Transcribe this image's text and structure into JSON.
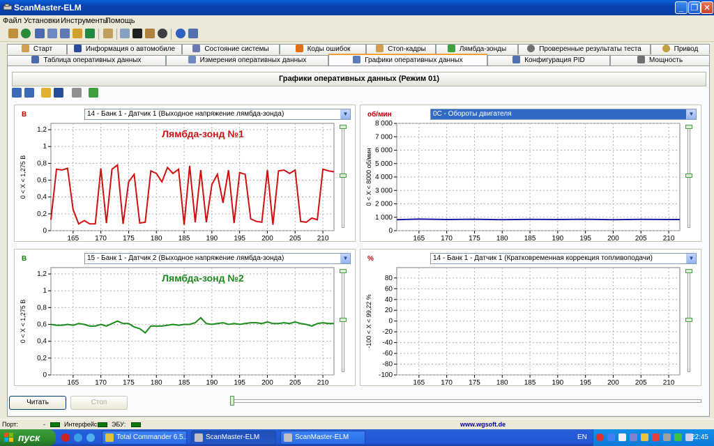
{
  "window": {
    "title": "ScanMaster-ELM"
  },
  "menu": [
    "Файл",
    "Установки",
    "Инструменты",
    "Помощь"
  ],
  "tabs_row1": [
    {
      "label": "Старт",
      "icon": "start-icon"
    },
    {
      "label": "Информация о автомобиле",
      "icon": "info-icon"
    },
    {
      "label": "Состояние системы",
      "icon": "system-status-icon"
    },
    {
      "label": "Коды ошибок",
      "icon": "warning-icon"
    },
    {
      "label": "Стоп-кадры",
      "icon": "freeze-frame-icon"
    },
    {
      "label": "Лямбда-зонды",
      "icon": "lambda-icon"
    },
    {
      "label": "Проверенные результаты теста",
      "icon": "gear-icon"
    },
    {
      "label": "Привод",
      "icon": "drive-icon"
    }
  ],
  "tabs_row2": [
    {
      "label": "Таблица оперативных данных",
      "icon": "table-icon"
    },
    {
      "label": "Измерения оперативных данных",
      "icon": "meter-icon"
    },
    {
      "label": "Графики оперативных данных",
      "icon": "graph-icon",
      "active": true
    },
    {
      "label": "Конфигурация PID",
      "icon": "pid-config-icon"
    },
    {
      "label": "Мощность",
      "icon": "power-icon"
    }
  ],
  "panel": {
    "header": "Графики оперативных данных (Режим 01)"
  },
  "chart_data": [
    {
      "type": "line",
      "unit_label": "В",
      "selector": "14 - Банк 1 - Датчик 1 (Выходное напряжение лямбда-зонда)",
      "annotation": "Лямбда-зонд №1",
      "ylabel": "0  < X <  1,275 В",
      "ylim": [
        0,
        1.275
      ],
      "yticks": [
        "0",
        "0,2",
        "0,4",
        "0,6",
        "0,8",
        "1",
        "1,2"
      ],
      "xlim": [
        161,
        212
      ],
      "xticks": [
        165,
        170,
        175,
        180,
        185,
        190,
        195,
        200,
        205,
        210
      ],
      "color": "#d01010",
      "series": [
        {
          "x": [
            161,
            162,
            163,
            164,
            165,
            166,
            167,
            168,
            169,
            170,
            171,
            172,
            173,
            174,
            175,
            176,
            177,
            178,
            179,
            180,
            181,
            182,
            183,
            184,
            185,
            186,
            187,
            188,
            189,
            190,
            191,
            192,
            193,
            194,
            195,
            196,
            197,
            198,
            199,
            200,
            201,
            202,
            203,
            204,
            205,
            206,
            207,
            208,
            209,
            210,
            211,
            212
          ],
          "values": [
            0.13,
            0.73,
            0.72,
            0.74,
            0.25,
            0.08,
            0.12,
            0.08,
            0.08,
            0.74,
            0.09,
            0.73,
            0.78,
            0.08,
            0.58,
            0.67,
            0.09,
            0.1,
            0.71,
            0.68,
            0.58,
            0.75,
            0.68,
            0.73,
            0.07,
            0.77,
            0.1,
            0.72,
            0.1,
            0.55,
            0.67,
            0.33,
            0.72,
            0.09,
            0.69,
            0.67,
            0.14,
            0.11,
            0.1,
            0.72,
            0.07,
            0.71,
            0.72,
            0.68,
            0.72,
            0.11,
            0.1,
            0.15,
            0.13,
            0.73,
            0.71,
            0.7
          ]
        }
      ]
    },
    {
      "type": "line",
      "unit_label": "об/мин",
      "selector": "0C - Обороты двигателя",
      "selector_highlighted": true,
      "annotation": "",
      "ylabel": "0  < X <  8000 об/мин",
      "ylim": [
        0,
        8000
      ],
      "yticks": [
        "0",
        "1 000",
        "2 000",
        "3 000",
        "4 000",
        "5 000",
        "6 000",
        "7 000",
        "8 000"
      ],
      "xlim": [
        161,
        212
      ],
      "xticks": [
        165,
        170,
        175,
        180,
        185,
        190,
        195,
        200,
        205,
        210
      ],
      "color": "#1a1aa8",
      "series": [
        {
          "x": [
            161,
            165,
            170,
            175,
            180,
            185,
            190,
            195,
            200,
            205,
            210,
            212
          ],
          "values": [
            820,
            860,
            830,
            850,
            820,
            840,
            830,
            850,
            820,
            840,
            830,
            830
          ]
        }
      ]
    },
    {
      "type": "line",
      "unit_label": "В",
      "selector": "15 - Банк 1 - Датчик 2 (Выходное напряжение лямбда-зонда)",
      "annotation": "Лямбда-зонд №2",
      "ylabel": "0  < X <  1,275 В",
      "ylim": [
        0,
        1.275
      ],
      "yticks": [
        "0",
        "0,2",
        "0,4",
        "0,6",
        "0,8",
        "1",
        "1,2"
      ],
      "xlim": [
        161,
        212
      ],
      "xticks": [
        165,
        170,
        175,
        180,
        185,
        190,
        195,
        200,
        205,
        210
      ],
      "color": "#1a8a1a",
      "series": [
        {
          "x": [
            161,
            162,
            163,
            164,
            165,
            166,
            167,
            168,
            169,
            170,
            171,
            172,
            173,
            174,
            175,
            176,
            177,
            178,
            179,
            180,
            181,
            182,
            183,
            184,
            185,
            186,
            187,
            188,
            189,
            190,
            191,
            192,
            193,
            194,
            195,
            196,
            197,
            198,
            199,
            200,
            201,
            202,
            203,
            204,
            205,
            206,
            207,
            208,
            209,
            210,
            211,
            212
          ],
          "values": [
            0.6,
            0.59,
            0.59,
            0.6,
            0.59,
            0.61,
            0.6,
            0.58,
            0.58,
            0.6,
            0.58,
            0.61,
            0.64,
            0.61,
            0.61,
            0.57,
            0.55,
            0.5,
            0.58,
            0.58,
            0.58,
            0.59,
            0.6,
            0.59,
            0.6,
            0.6,
            0.62,
            0.68,
            0.61,
            0.6,
            0.61,
            0.62,
            0.6,
            0.61,
            0.6,
            0.61,
            0.62,
            0.62,
            0.61,
            0.63,
            0.61,
            0.61,
            0.62,
            0.61,
            0.63,
            0.61,
            0.6,
            0.58,
            0.61,
            0.62,
            0.61,
            0.61
          ]
        }
      ]
    },
    {
      "type": "line",
      "unit_label": "%",
      "selector": "14 - Банк 1 - Датчик 1 (Кратковременная коррекция топливоподачи)",
      "annotation": "",
      "ylabel": "-100  < X <  99,22 %",
      "ylim": [
        -100,
        99.22
      ],
      "yticks": [
        "-100",
        "-80",
        "-60",
        "-40",
        "-20",
        "0",
        "20",
        "40",
        "60",
        "80"
      ],
      "xlim": [
        161,
        212
      ],
      "xticks": [
        165,
        170,
        175,
        180,
        185,
        190,
        195,
        200,
        205,
        210
      ],
      "color": "#1a1aa8",
      "series": [
        {
          "x": [],
          "values": []
        }
      ]
    }
  ],
  "buttons": {
    "read": "Читать",
    "stop": "Стоп"
  },
  "status": {
    "port_label": "Порт:",
    "port_value": "-",
    "interface_label": "Интерфейс:",
    "ecu_label": "ЭБУ:",
    "url": "www.wgsoft.de"
  },
  "taskbar": {
    "start": "пуск",
    "tasks": [
      "Total Commander 6.5...",
      "ScanMaster-ELM",
      "ScanMaster-ELM"
    ],
    "lang": "EN",
    "clock": "22:45"
  }
}
